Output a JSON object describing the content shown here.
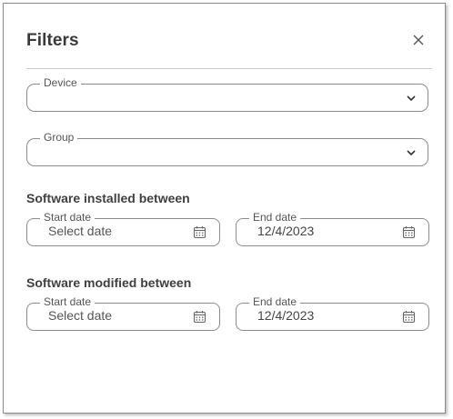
{
  "dialog": {
    "title": "Filters"
  },
  "device": {
    "label": "Device"
  },
  "group": {
    "label": "Group"
  },
  "installed": {
    "heading": "Software installed between",
    "start": {
      "label": "Start date",
      "value": "Select date"
    },
    "end": {
      "label": "End date",
      "value": "12/4/2023"
    }
  },
  "modified": {
    "heading": "Software modified between",
    "start": {
      "label": "Start date",
      "value": "Select date"
    },
    "end": {
      "label": "End date",
      "value": "12/4/2023"
    }
  },
  "icons": {
    "close": "close-icon",
    "chevron": "chevron-down-icon",
    "calendar": "calendar-icon"
  },
  "colors": {
    "border": "#8c8c8c",
    "text": "#3a3a3a",
    "divider": "#c8c8c8"
  }
}
